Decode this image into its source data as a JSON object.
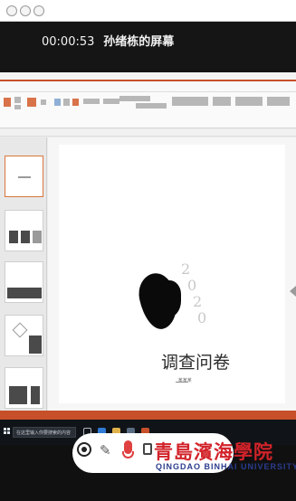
{
  "recording": {
    "timestamp": "00:00:53",
    "title": "孙绪栋的屏幕"
  },
  "ppt": {
    "quick_bar_left": "",
    "quick_bar_mid": "",
    "status_left": ""
  },
  "slide": {
    "year_chars": [
      "2",
      "0",
      "2",
      "0"
    ],
    "title": "调查问卷",
    "subtitle": "_某某某"
  },
  "taskbar": {
    "search_placeholder": "在这里输入你要搜索的内容",
    "tray_text": "",
    "icons": [
      "task-view-icon",
      "edge-icon",
      "explorer-icon",
      "store-icon",
      "powerpoint-icon"
    ]
  },
  "logo": {
    "cn": "青島濱海學院",
    "en": "QINGDAO BINHAI UNIVERSITY"
  },
  "colors": {
    "ppt_accent": "#c7502a",
    "logo_red": "#d2232a",
    "logo_blue": "#2b3d8f",
    "mic_red": "#e04040"
  }
}
